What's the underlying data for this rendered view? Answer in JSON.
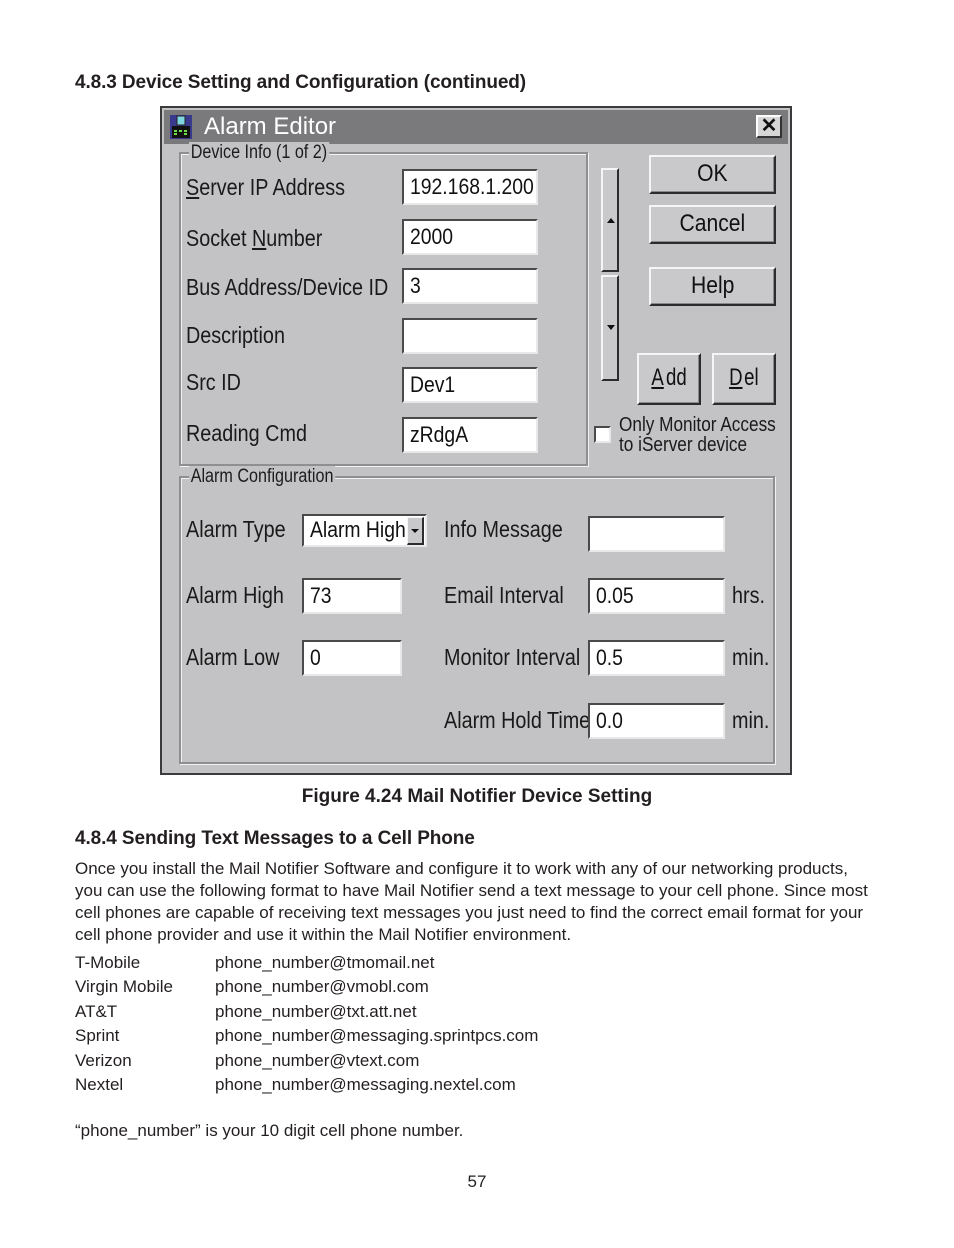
{
  "section_heading": "4.8.3  Device Setting and Configuration (continued)",
  "dialog": {
    "title": "Alarm Editor",
    "title_icon": "device-icon",
    "close_icon": "close-icon",
    "device_info": {
      "group_label": "Device Info  (1 of 2)",
      "fields": [
        {
          "label_prefix": "",
          "label_mnemonic": "S",
          "label_suffix": "erver IP Address",
          "value": "192.168.1.200"
        },
        {
          "label_prefix": "Socket ",
          "label_mnemonic": "N",
          "label_suffix": "umber",
          "value": "2000"
        },
        {
          "label_prefix": "Bus Address/Device ID",
          "label_mnemonic": "",
          "label_suffix": "",
          "value": "3"
        },
        {
          "label_prefix": "Description",
          "label_mnemonic": "",
          "label_suffix": "",
          "value": ""
        },
        {
          "label_prefix": "Src ID",
          "label_mnemonic": "",
          "label_suffix": "",
          "value": "Dev1"
        },
        {
          "label_prefix": "Reading Cmd",
          "label_mnemonic": "",
          "label_suffix": "",
          "value": "zRdgA"
        }
      ]
    },
    "buttons": {
      "ok": "OK",
      "cancel": "Cancel",
      "help": "Help",
      "add_mnemonic": "A",
      "add_rest": "dd",
      "del_mnemonic": "D",
      "del_rest": "el"
    },
    "scroll": {
      "up_icon": "arrow-up-icon",
      "down_icon": "arrow-down-icon"
    },
    "checkbox": {
      "label_line1": "Only Monitor Access",
      "label_line2": "to iServer device",
      "checked": false
    },
    "alarm_config": {
      "group_label": "Alarm Configuration",
      "alarm_type_label": "Alarm Type",
      "alarm_type_value": "Alarm High",
      "alarm_high_label": "Alarm High",
      "alarm_high_value": "73",
      "alarm_low_label": "Alarm Low",
      "alarm_low_value": "0",
      "info_message_label": "Info Message",
      "info_message_value": "",
      "email_interval_label": "Email Interval",
      "email_interval_value": "0.05",
      "email_interval_unit": "hrs.",
      "monitor_interval_label": "Monitor Interval",
      "monitor_interval_value": "0.5",
      "monitor_interval_unit": "min.",
      "alarm_hold_label": "Alarm Hold Time",
      "alarm_hold_value": "0.0",
      "alarm_hold_unit": "min."
    }
  },
  "figure_caption": "Figure 4.24  Mail Notifier Device Setting",
  "section2_heading": "4.8.4  Sending Text Messages to a Cell Phone",
  "paragraph": "Once you install the Mail Notifier Software and configure it to work with any of our networking products, you can use the following format to have Mail Notifier send a text message to your cell phone. Since most cell phones are capable of receiving text messages you just need to find the correct email format for your cell phone provider and use it within the Mail Notifier environment.",
  "providers": [
    {
      "name": "T-Mobile",
      "format": "phone_number@tmomail.net"
    },
    {
      "name": "Virgin Mobile",
      "format": "phone_number@vmobl.com"
    },
    {
      "name": "AT&T",
      "format": "phone_number@txt.att.net"
    },
    {
      "name": "Sprint",
      "format": "phone_number@messaging.sprintpcs.com"
    },
    {
      "name": "Verizon",
      "format": "phone_number@vtext.com"
    },
    {
      "name": "Nextel",
      "format": "phone_number@messaging.nextel.com"
    }
  ],
  "note": "“phone_number” is your 10 digit cell phone number.",
  "page_number": "57"
}
